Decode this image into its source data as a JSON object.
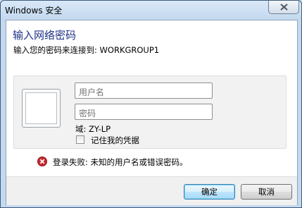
{
  "window": {
    "title": "Windows 安全"
  },
  "dialog": {
    "heading": "输入网络密码",
    "subtext": "输入您的密码来连接到: WORKGROUP1"
  },
  "credentials": {
    "username_placeholder": "用户名",
    "password_placeholder": "密码",
    "domain_text": "域: ZY-LP",
    "remember_label": "记住我的凭据",
    "remember_checked": false
  },
  "error": {
    "message": "登录失败: 未知的用户名或错误密码。",
    "icon": "error-icon"
  },
  "buttons": {
    "ok_label": "确定",
    "cancel_label": "取消"
  },
  "colors": {
    "heading": "#1e3287",
    "frame": "#c4d9ef",
    "error": "#c8282e"
  }
}
